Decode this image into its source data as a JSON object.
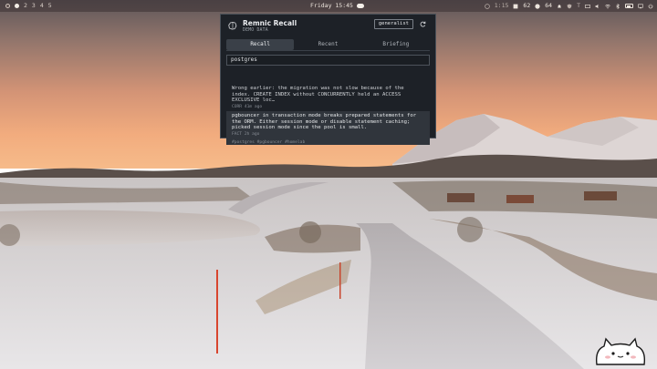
{
  "topbar": {
    "workspaces": [
      "2",
      "3",
      "4",
      "5"
    ],
    "clock": "Friday 15:45",
    "tray": {
      "time_dim": "1:15",
      "count_62": "62",
      "count_64": "64",
      "tag": "T"
    }
  },
  "panel": {
    "title": "Remnic Recall",
    "subtitle": "DEMO DATA",
    "namespace_badge": "generalist",
    "tabs": [
      {
        "label": "Recall",
        "active": true
      },
      {
        "label": "Recent",
        "active": false
      },
      {
        "label": "Briefing",
        "active": false
      }
    ],
    "search": {
      "value": "postgres"
    },
    "results": [
      {
        "text": "Wrong earlier: the migration was not slow because of the index. CREATE INDEX without CONCURRENTLY held an ACCESS EXCLUSIVE loc…",
        "meta": "CORR 41m ago"
      },
      {
        "text": "pgbouncer in transaction mode breaks prepared statements for the ORM. Either session mode or disable statement caching; picked session mode since the pool is small.",
        "meta": "FACT 2h ago",
        "tags": "#postgres #pgbouncer #homelab"
      }
    ]
  },
  "colors": {
    "panel_bg": "#1d2127",
    "active_tab": "#3a4048",
    "sky_top": "#6a5e62",
    "sky_bottom": "#f0a878"
  },
  "icons": [
    "brain-icon",
    "refresh-icon",
    "cloud-icon",
    "battery-icon",
    "wifi-icon",
    "volume-icon",
    "bluetooth-icon",
    "bell-icon",
    "power-icon"
  ]
}
